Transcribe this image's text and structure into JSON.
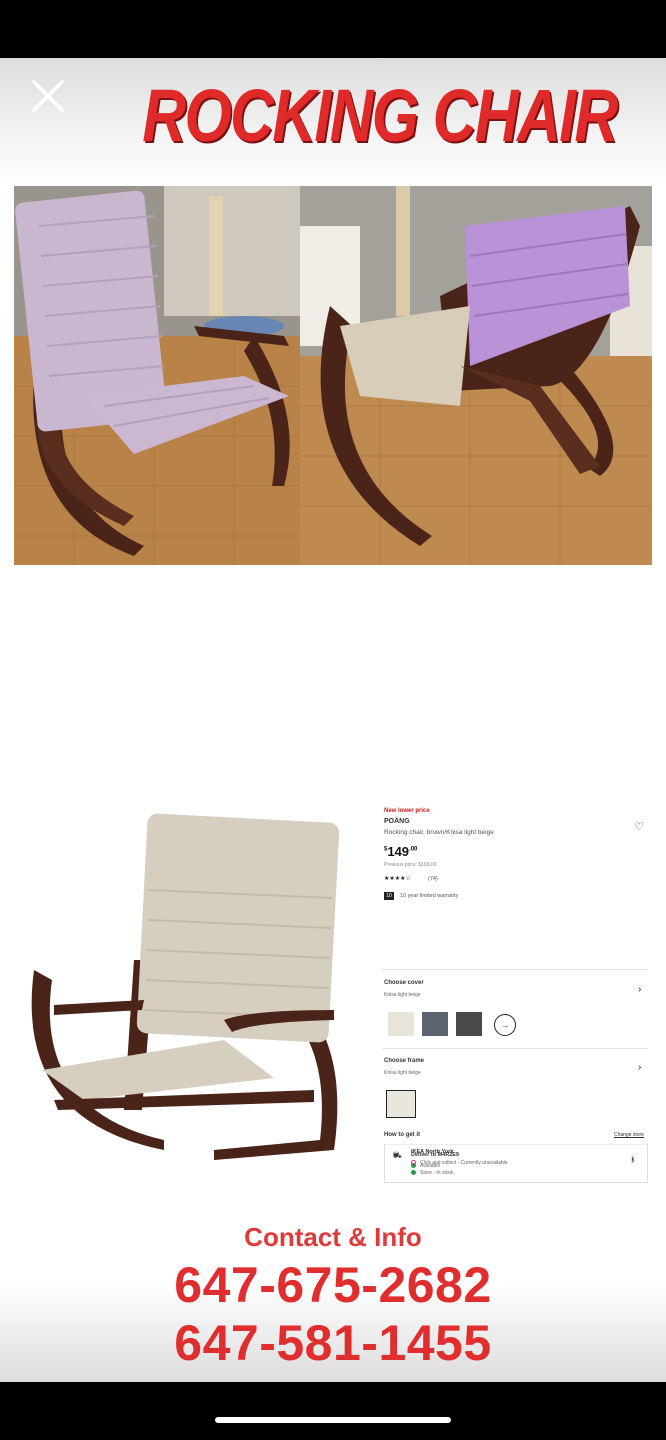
{
  "story": {
    "title": "ROCKING CHAIR",
    "close_icon": "close-icon"
  },
  "listing": {
    "badge": "New lower price",
    "name": "POÄNG",
    "description": "Rocking chair, brown/Knisa light beige",
    "price_symbol": "$",
    "price_main": "149",
    "price_cents": ".00",
    "previous_price": "Previous price: $169.00",
    "rating_stars": "★★★★☆",
    "rating_count": "(74)",
    "warranty_badge": "10",
    "warranty_text": "10 year limited warranty",
    "cover_label": "Choose cover",
    "cover_value": "Knisa light beige",
    "frame_label": "Choose frame",
    "frame_value": "Knisa light beige",
    "get_it_label": "How to get it",
    "change_store": "Change store",
    "deliver_label": "Deliver to M4R2E9",
    "deliver_status": "Available",
    "store_label": "IKEA North York",
    "store_status1": "Click and collect - Currently unavailable",
    "store_status2": "Store - In stock",
    "colors": {
      "available": "#1e9e4a",
      "unavailable": "#c8327a"
    }
  },
  "contact": {
    "heading": "Contact & Info",
    "phone1": "647-675-2682",
    "phone2": "647-581-1455"
  },
  "colors": {
    "accent_red": "#e02a2a",
    "chair_frame": "#4a2418",
    "cushion_photo": "#c9b6cf",
    "cushion_beige": "#d6cfbf",
    "floor": "#c98a45"
  }
}
